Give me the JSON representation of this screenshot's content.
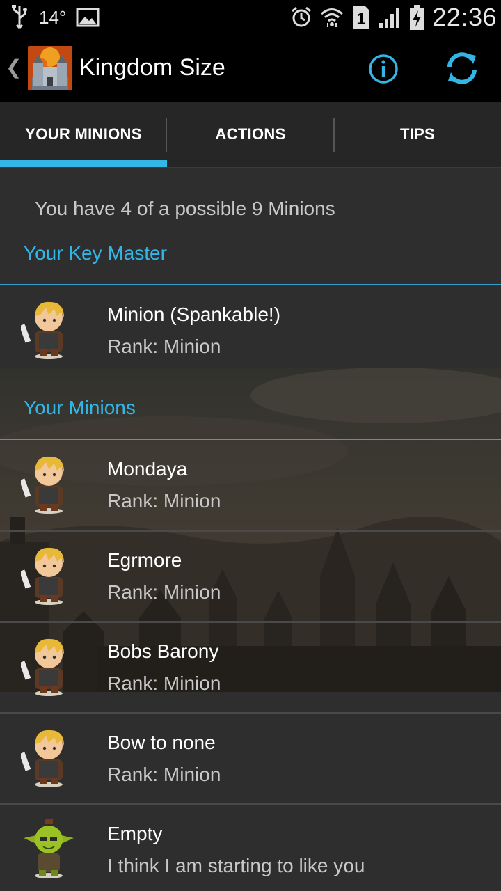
{
  "status_bar": {
    "temperature": "14°",
    "network_badge": "1",
    "time": "22:36",
    "icons": [
      "usb-icon",
      "image-icon",
      "alarm-icon",
      "wifi-icon",
      "sim-icon",
      "signal-icon",
      "battery-charging-icon"
    ]
  },
  "action_bar": {
    "title": "Kingdom Size",
    "info_icon": "info-icon",
    "refresh_icon": "refresh-icon",
    "accent": "#33b5e5"
  },
  "tabs": [
    {
      "label": "YOUR MINIONS",
      "selected": true
    },
    {
      "label": "ACTIONS",
      "selected": false
    },
    {
      "label": "TIPS",
      "selected": false
    }
  ],
  "summary": "You have 4 of a possible 9 Minions",
  "sections": {
    "key_master": "Your Key Master",
    "minions": "Your Minions"
  },
  "key_master": {
    "name": "Minion (Spankable!)",
    "subtitle": "Rank: Minion",
    "avatar": "knight-avatar"
  },
  "minions": [
    {
      "name": "Mondaya",
      "subtitle": "Rank: Minion",
      "avatar": "knight-avatar"
    },
    {
      "name": "Egrmore",
      "subtitle": "Rank: Minion",
      "avatar": "knight-avatar"
    },
    {
      "name": "Bobs Barony",
      "subtitle": "Rank: Minion",
      "avatar": "knight-avatar"
    },
    {
      "name": "Bow to none",
      "subtitle": "Rank: Minion",
      "avatar": "knight-avatar"
    },
    {
      "name": "Empty",
      "subtitle": "I think I am starting to like you",
      "avatar": "goblin-avatar"
    }
  ]
}
